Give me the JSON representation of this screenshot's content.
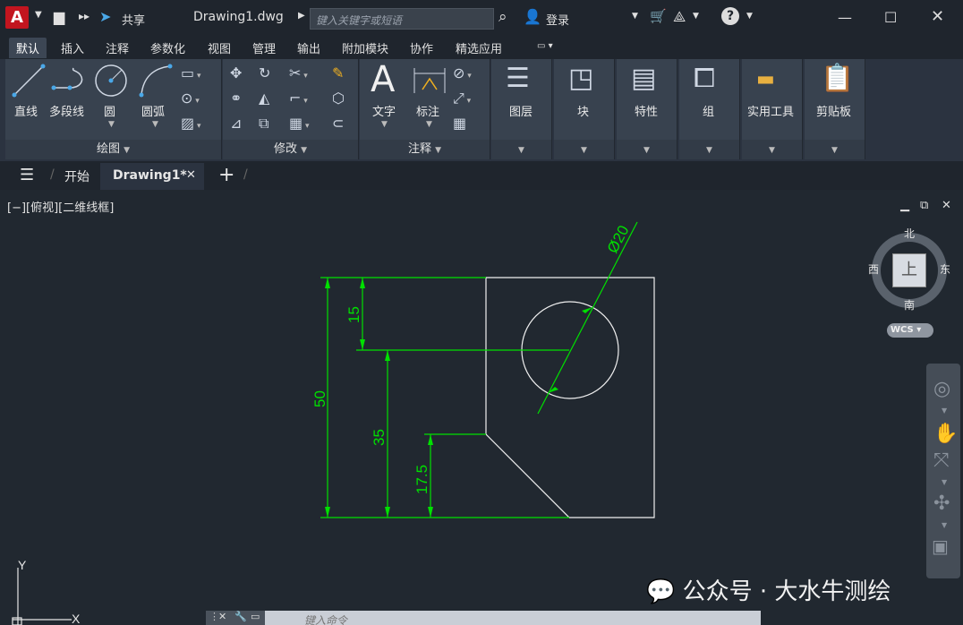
{
  "titlebar": {
    "app_logo": "A",
    "share": "共享",
    "filename": "Drawing1.dwg",
    "search_placeholder": "键入关键字或短语",
    "login": "登录"
  },
  "ribbon_tabs": [
    "默认",
    "插入",
    "注释",
    "参数化",
    "视图",
    "管理",
    "输出",
    "附加模块",
    "协作",
    "精选应用"
  ],
  "ribbon": {
    "draw": {
      "line": "直线",
      "polyline": "多段线",
      "circle": "圆",
      "arc": "圆弧",
      "footer": "绘图"
    },
    "modify": {
      "footer": "修改"
    },
    "annotation": {
      "text": "文字",
      "dimension": "标注",
      "footer": "注释"
    },
    "layers": "图层",
    "block": "块",
    "properties": "特性",
    "groups": "组",
    "utilities": "实用工具",
    "clipboard": "剪贴板"
  },
  "doc_tabs": {
    "start": "开始",
    "current": "Drawing1*"
  },
  "viewport": {
    "label": "[−][俯视][二维线框]",
    "viewcube": {
      "north": "北",
      "south": "南",
      "east": "东",
      "west": "西",
      "top": "上",
      "wcs": "WCS"
    },
    "ucs": {
      "x": "X",
      "y": "Y"
    }
  },
  "drawing": {
    "dims": {
      "d50": "50",
      "d15": "15",
      "d35": "35",
      "d175": "17.5",
      "dia": "Ø20"
    }
  },
  "command_line": {
    "placeholder": "键入命令"
  },
  "watermark": "公众号 · 大水牛测绘",
  "colors": {
    "dim": "#00e000",
    "geom": "#f0f0f0",
    "bg": "#212830"
  }
}
